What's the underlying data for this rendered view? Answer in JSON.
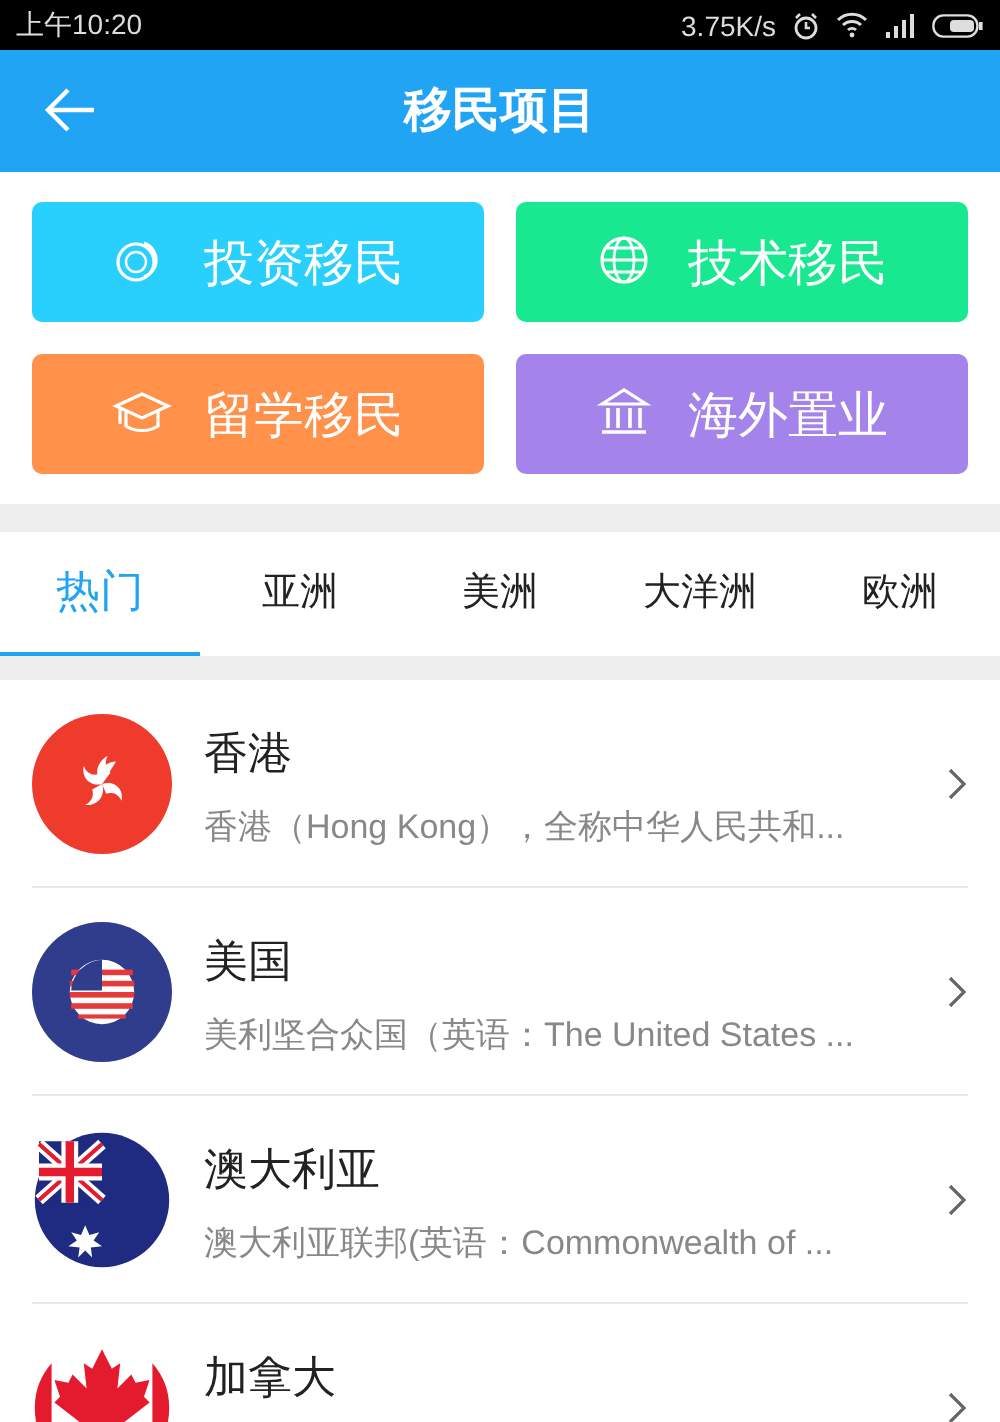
{
  "status_bar": {
    "time": "上午10:20",
    "speed": "3.75K/s"
  },
  "header": {
    "title": "移民项目"
  },
  "categories": [
    {
      "label": "投资移民",
      "kind": "coins",
      "color": "#29d0fe"
    },
    {
      "label": "技术移民",
      "kind": "globe",
      "color": "#18e890"
    },
    {
      "label": "留学移民",
      "kind": "cap",
      "color": "#ff914a"
    },
    {
      "label": "海外置业",
      "kind": "bank",
      "color": "#a483ea"
    }
  ],
  "tabs": [
    {
      "label": "热门",
      "selected": true
    },
    {
      "label": "亚洲",
      "selected": false
    },
    {
      "label": "美洲",
      "selected": false
    },
    {
      "label": "大洋洲",
      "selected": false
    },
    {
      "label": "欧洲",
      "selected": false
    }
  ],
  "countries": [
    {
      "name": "香港",
      "summary": "香港（Hong Kong），全称中华人民共和...",
      "kind": "hk"
    },
    {
      "name": "美国",
      "summary": "美利坚合众国（英语：The United States ...",
      "kind": "us"
    },
    {
      "name": "澳大利亚",
      "summary": "澳大利亚联邦(英语：Commonwealth of ...",
      "kind": "au"
    },
    {
      "name": "加拿大",
      "kind": "ca"
    }
  ]
}
